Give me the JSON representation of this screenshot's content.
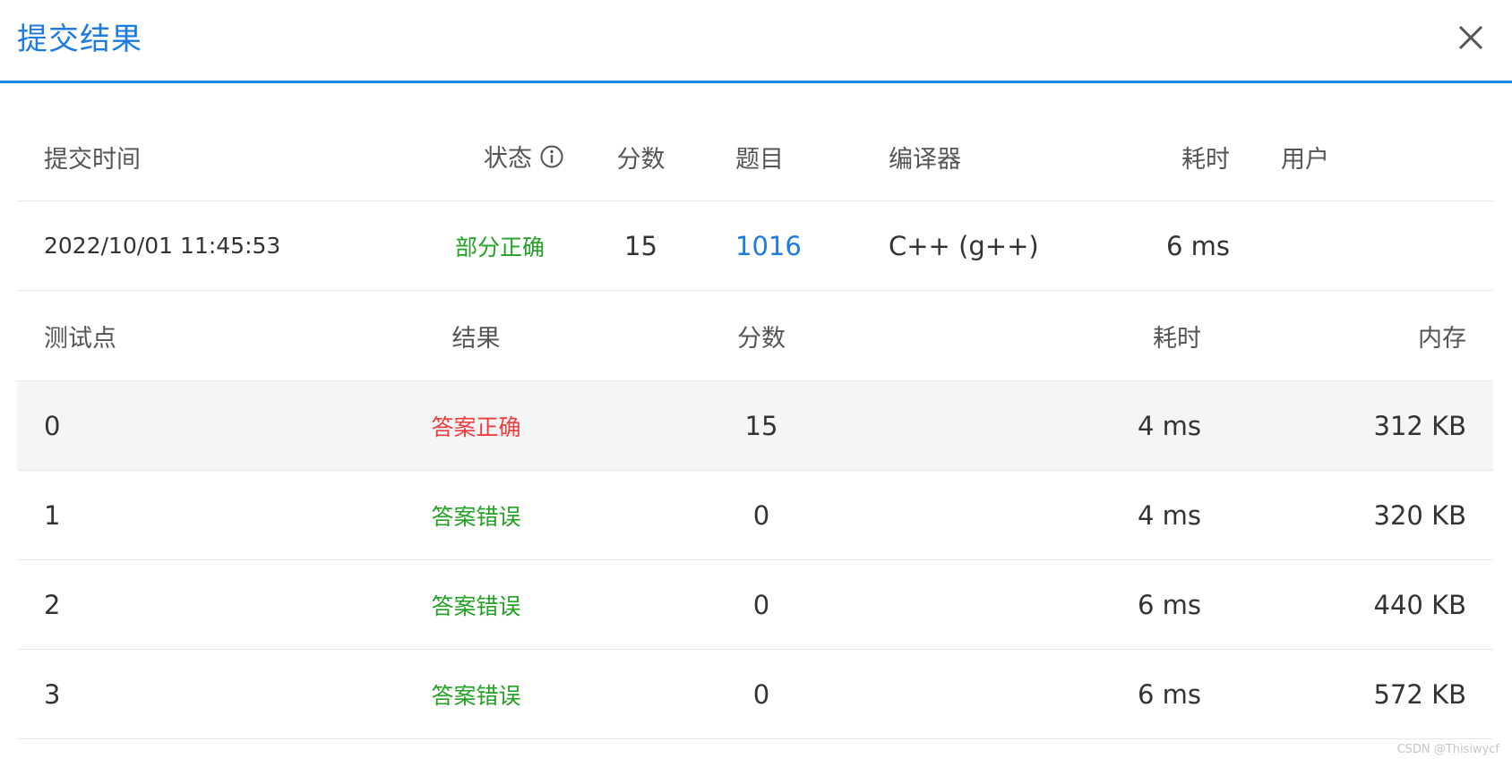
{
  "dialog": {
    "title": "提交结果"
  },
  "summary": {
    "headers": {
      "submit_time": "提交时间",
      "status": "状态",
      "score": "分数",
      "problem": "题目",
      "compiler": "编译器",
      "time": "耗时",
      "user": "用户"
    },
    "row": {
      "submit_time": "2022/10/01 11:45:53",
      "status": "部分正确",
      "score": "15",
      "problem": "1016",
      "compiler": "C++ (g++)",
      "time": "6 ms",
      "user": ""
    }
  },
  "cases": {
    "headers": {
      "case": "测试点",
      "result": "结果",
      "score": "分数",
      "time": "耗时",
      "memory": "内存"
    },
    "rows": [
      {
        "case": "0",
        "result": "答案正确",
        "score": "15",
        "time": "4 ms",
        "memory": "312 KB"
      },
      {
        "case": "1",
        "result": "答案错误",
        "score": "0",
        "time": "4 ms",
        "memory": "320 KB"
      },
      {
        "case": "2",
        "result": "答案错误",
        "score": "0",
        "time": "6 ms",
        "memory": "440 KB"
      },
      {
        "case": "3",
        "result": "答案错误",
        "score": "0",
        "time": "6 ms",
        "memory": "572 KB"
      }
    ]
  },
  "colors": {
    "accent": "#1e7be0",
    "partial": "#23a123",
    "correct": "#f23c3c",
    "wrong": "#23a123",
    "row_highlight": "#f4f5f7"
  },
  "watermark": "CSDN @Thisiwycf"
}
